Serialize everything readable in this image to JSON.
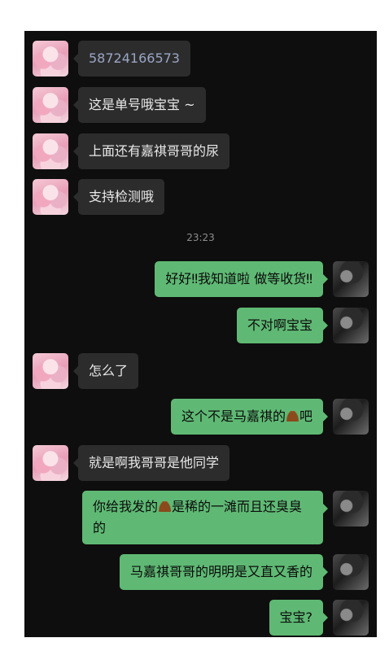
{
  "chat": {
    "timestamp": "23:23",
    "messages": [
      {
        "side": "left",
        "text": "58724166573"
      },
      {
        "side": "left",
        "text": "这是单号哦宝宝 ~"
      },
      {
        "side": "left",
        "text": "上面还有嘉祺哥哥的尿"
      },
      {
        "side": "left",
        "text": "支持检测哦"
      },
      {
        "side": "right",
        "text": "好好‼我知道啦 做等收货‼"
      },
      {
        "side": "right",
        "text": "不对啊宝宝"
      },
      {
        "side": "left",
        "text": "怎么了"
      },
      {
        "side": "right",
        "text_before": "这个不是马嘉祺的",
        "emoji": "pile-of-poo",
        "text_after": "吧"
      },
      {
        "side": "left",
        "text": "就是啊我哥哥是他同学"
      },
      {
        "side": "right",
        "text_before": "你给我发的",
        "emoji": "pile-of-poo",
        "text_after": "是稀的一滩而且还臭臭的"
      },
      {
        "side": "right",
        "text": "马嘉祺哥哥的明明是又直又香的"
      },
      {
        "side": "right",
        "text": "宝宝?"
      }
    ]
  },
  "colors": {
    "background": "#0e0e0e",
    "incoming_bubble": "#2c2c2c",
    "outgoing_bubble": "#5fb974",
    "number_link": "#9aa6c6"
  }
}
